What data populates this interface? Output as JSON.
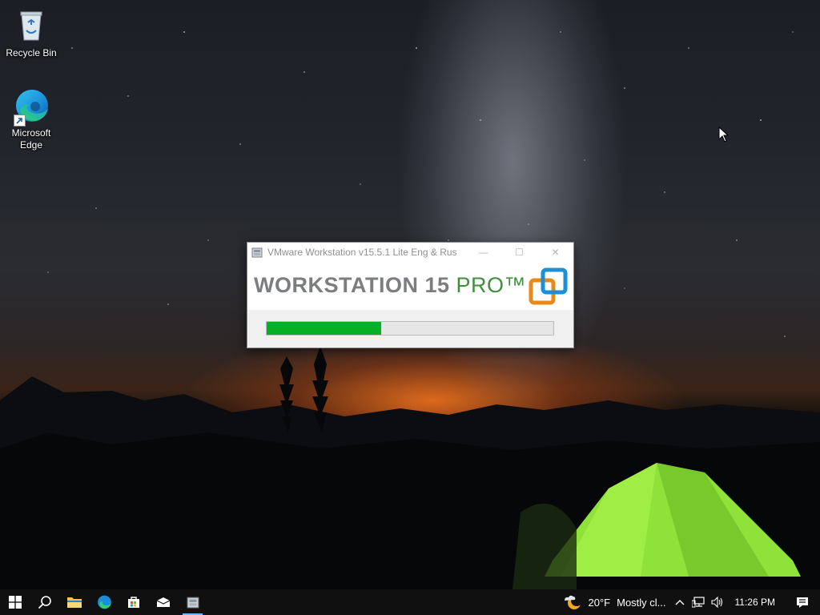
{
  "desktop": {
    "icons": [
      {
        "label": "Recycle Bin",
        "icon": "recycle-bin-icon"
      },
      {
        "label": "Microsoft Edge",
        "icon": "edge-icon"
      }
    ]
  },
  "installer": {
    "title": "VMware Workstation v15.5.1 Lite Eng & Rus",
    "brand_main": "WORKSTATION 15 ",
    "brand_edition": "PRO™",
    "progress_fraction": 0.4,
    "progress_color": "#06b025",
    "controls": {
      "minimize": "—",
      "maximize": "☐",
      "close": "✕"
    }
  },
  "taskbar": {
    "apps": [
      {
        "name": "start-button",
        "icon": "windows-logo-icon"
      },
      {
        "name": "search-button",
        "icon": "search-icon"
      },
      {
        "name": "file-explorer",
        "icon": "folder-icon"
      },
      {
        "name": "edge",
        "icon": "edge-icon"
      },
      {
        "name": "store",
        "icon": "store-icon"
      },
      {
        "name": "mail",
        "icon": "mail-icon"
      },
      {
        "name": "installer",
        "icon": "installer-icon",
        "active": true
      }
    ],
    "weather": {
      "temp": "20°F",
      "condition": "Mostly cl..."
    },
    "time": "11:26 PM"
  },
  "colors": {
    "accent": "#6fb6ff",
    "taskbar": "#101010"
  }
}
